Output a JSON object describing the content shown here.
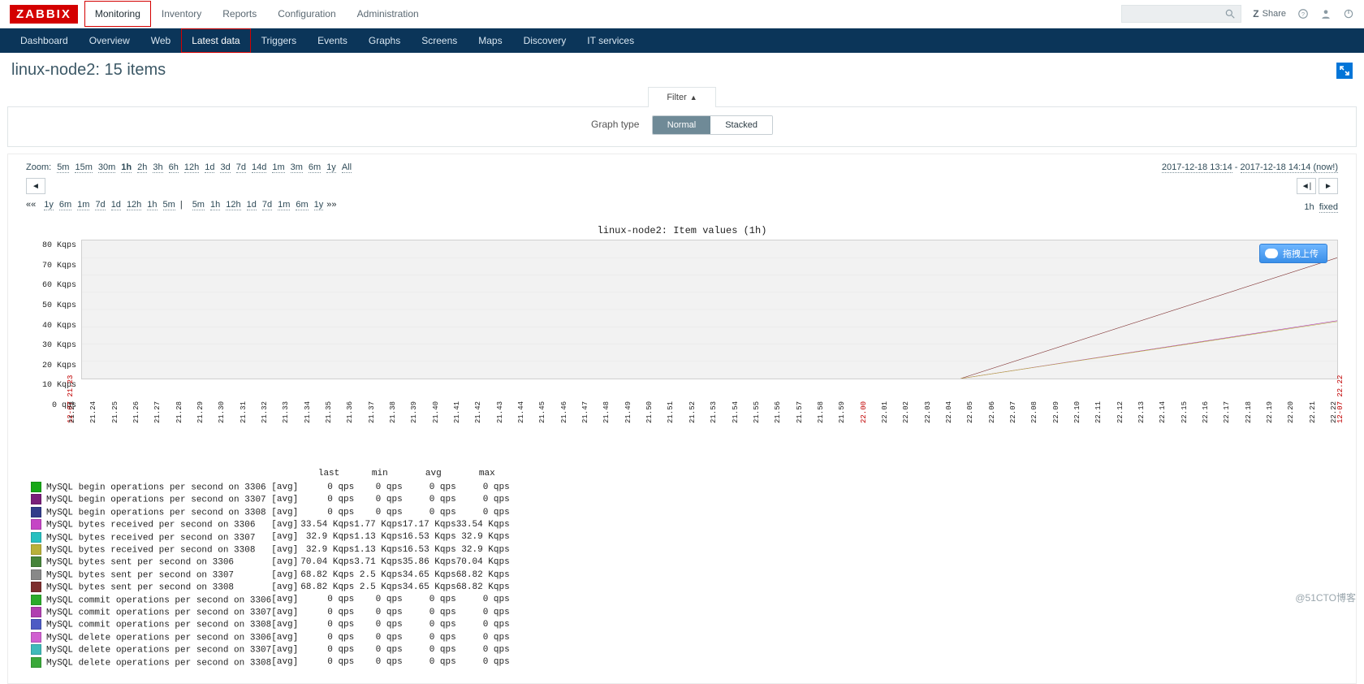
{
  "brand": "ZABBIX",
  "top_nav": {
    "items": [
      "Monitoring",
      "Inventory",
      "Reports",
      "Configuration",
      "Administration"
    ],
    "active": 0
  },
  "top_right": {
    "share": "Share"
  },
  "sub_nav": {
    "items": [
      "Dashboard",
      "Overview",
      "Web",
      "Latest data",
      "Triggers",
      "Events",
      "Graphs",
      "Screens",
      "Maps",
      "Discovery",
      "IT services"
    ],
    "active": 3
  },
  "page_title": "linux-node2: 15 items",
  "filter": {
    "tab_label": "Filter",
    "graph_type_label": "Graph type",
    "option_normal": "Normal",
    "option_stacked": "Stacked"
  },
  "zoom": {
    "label": "Zoom:",
    "levels": [
      "5m",
      "15m",
      "30m",
      "1h",
      "2h",
      "3h",
      "6h",
      "12h",
      "1d",
      "3d",
      "7d",
      "14d",
      "1m",
      "3m",
      "6m",
      "1y",
      "All"
    ],
    "selected": "1h"
  },
  "time_range": {
    "from": "2017-12-18 13:14",
    "sep": " - ",
    "to": "2017-12-18 14:14 (now!)"
  },
  "step_left": [
    "1y",
    "6m",
    "1m",
    "7d",
    "1d",
    "12h",
    "1h",
    "5m"
  ],
  "step_right": [
    "5m",
    "1h",
    "12h",
    "1d",
    "7d",
    "1m",
    "6m",
    "1y"
  ],
  "fixed": {
    "span": "1h",
    "mode": "fixed"
  },
  "upload_label": "拖拽上传",
  "chart_data": {
    "type": "line",
    "title": "linux-node2: Item values (1h)",
    "ylabel": "qps",
    "ylim": [
      0,
      80
    ],
    "yticks": [
      "80 Kqps",
      "70 Kqps",
      "60 Kqps",
      "50 Kqps",
      "40 Kqps",
      "30 Kqps",
      "20 Kqps",
      "10 Kqps",
      "0 qps"
    ],
    "x_start_label": "12-07 21.23",
    "x_end_label": "12-07 22.22",
    "xticks": [
      "21.23",
      "21.24",
      "21.25",
      "21.26",
      "21.27",
      "21.28",
      "21.29",
      "21.30",
      "21.31",
      "21.32",
      "21.33",
      "21.34",
      "21.35",
      "21.36",
      "21.37",
      "21.38",
      "21.39",
      "21.40",
      "21.41",
      "21.42",
      "21.43",
      "21.44",
      "21.45",
      "21.46",
      "21.47",
      "21.48",
      "21.49",
      "21.50",
      "21.51",
      "21.52",
      "21.53",
      "21.54",
      "21.55",
      "21.56",
      "21.57",
      "21.58",
      "21.59",
      "22.00",
      "22.01",
      "22.02",
      "22.03",
      "22.04",
      "22.05",
      "22.06",
      "22.07",
      "22.08",
      "22.09",
      "22.10",
      "22.11",
      "22.12",
      "22.13",
      "22.14",
      "22.15",
      "22.16",
      "22.17",
      "22.18",
      "22.19",
      "22.20",
      "22.21",
      "22.22"
    ],
    "red_tick": "22.00",
    "series_visible": [
      {
        "name": "MySQL bytes sent per second on 3306",
        "color": "#7e2f2f",
        "start_x": 0.7,
        "start_y": 0,
        "end_y": 70
      },
      {
        "name": "MySQL bytes received per second on 3306",
        "color": "#b03fb0",
        "start_x": 0.7,
        "start_y": 0,
        "end_y": 33.5
      },
      {
        "name": "MySQL bytes received per second on 3307",
        "color": "#b9b13a",
        "start_x": 0.7,
        "start_y": 0,
        "end_y": 33
      }
    ],
    "legend_headers": [
      "last",
      "min",
      "avg",
      "max"
    ],
    "legend": [
      {
        "c": "#17a817",
        "n": "MySQL begin operations per second on 3306",
        "a": "[avg]",
        "v": [
          "0 qps",
          "0 qps",
          "0 qps",
          "0 qps"
        ]
      },
      {
        "c": "#7a1f7a",
        "n": "MySQL begin operations per second on 3307",
        "a": "[avg]",
        "v": [
          "0 qps",
          "0 qps",
          "0 qps",
          "0 qps"
        ]
      },
      {
        "c": "#323c8a",
        "n": "MySQL begin operations per second on 3308",
        "a": "[avg]",
        "v": [
          "0 qps",
          "0 qps",
          "0 qps",
          "0 qps"
        ]
      },
      {
        "c": "#c545c5",
        "n": "MySQL bytes received per second on 3306",
        "a": "[avg]",
        "v": [
          "33.54 Kqps",
          "1.77 Kqps",
          "17.17 Kqps",
          "33.54 Kqps"
        ]
      },
      {
        "c": "#27c0c0",
        "n": "MySQL bytes received per second on 3307",
        "a": "[avg]",
        "v": [
          "32.9 Kqps",
          "1.13 Kqps",
          "16.53 Kqps",
          "32.9 Kqps"
        ]
      },
      {
        "c": "#b9b13a",
        "n": "MySQL bytes received per second on 3308",
        "a": "[avg]",
        "v": [
          "32.9 Kqps",
          "1.13 Kqps",
          "16.53 Kqps",
          "32.9 Kqps"
        ]
      },
      {
        "c": "#46843a",
        "n": "MySQL bytes sent per second on 3306",
        "a": "[avg]",
        "v": [
          "70.04 Kqps",
          "3.71 Kqps",
          "35.86 Kqps",
          "70.04 Kqps"
        ]
      },
      {
        "c": "#888888",
        "n": "MySQL bytes sent per second on 3307",
        "a": "[avg]",
        "v": [
          "68.82 Kqps",
          "2.5 Kqps",
          "34.65 Kqps",
          "68.82 Kqps"
        ]
      },
      {
        "c": "#7e2f2f",
        "n": "MySQL bytes sent per second on 3308",
        "a": "[avg]",
        "v": [
          "68.82 Kqps",
          "2.5 Kqps",
          "34.65 Kqps",
          "68.82 Kqps"
        ]
      },
      {
        "c": "#2bab2b",
        "n": "MySQL commit operations per second on 3306",
        "a": "[avg]",
        "v": [
          "0 qps",
          "0 qps",
          "0 qps",
          "0 qps"
        ]
      },
      {
        "c": "#b03fb0",
        "n": "MySQL commit operations per second on 3307",
        "a": "[avg]",
        "v": [
          "0 qps",
          "0 qps",
          "0 qps",
          "0 qps"
        ]
      },
      {
        "c": "#4e5bc4",
        "n": "MySQL commit operations per second on 3308",
        "a": "[avg]",
        "v": [
          "0 qps",
          "0 qps",
          "0 qps",
          "0 qps"
        ]
      },
      {
        "c": "#d060d0",
        "n": "MySQL delete operations per second on 3306",
        "a": "[avg]",
        "v": [
          "0 qps",
          "0 qps",
          "0 qps",
          "0 qps"
        ]
      },
      {
        "c": "#3fbaba",
        "n": "MySQL delete operations per second on 3307",
        "a": "[avg]",
        "v": [
          "0 qps",
          "0 qps",
          "0 qps",
          "0 qps"
        ]
      },
      {
        "c": "#3aa83a",
        "n": "MySQL delete operations per second on 3308",
        "a": "[avg]",
        "v": [
          "0 qps",
          "0 qps",
          "0 qps",
          "0 qps"
        ]
      }
    ]
  },
  "watermark": "@51CTO博客"
}
